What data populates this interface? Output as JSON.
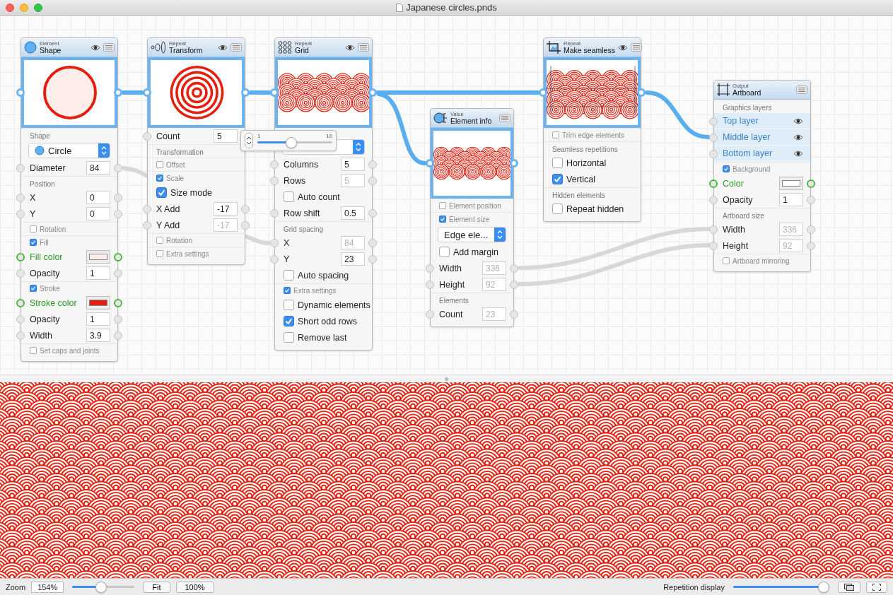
{
  "window": {
    "title": "Japanese circles.pnds"
  },
  "nodes": [
    {
      "category": "Element",
      "title": "Shape",
      "eye": true,
      "rows": [
        {
          "kind": "section",
          "label": "Shape"
        },
        {
          "kind": "select",
          "value": "Circle",
          "dot": true
        },
        {
          "kind": "field",
          "label": "Diameter",
          "value": "84",
          "dimmed": false
        },
        {
          "kind": "section",
          "label": "Position"
        },
        {
          "kind": "field",
          "label": "X",
          "value": "0",
          "dimmed": false
        },
        {
          "kind": "field",
          "label": "Y",
          "value": "0",
          "dimmed": false
        },
        {
          "kind": "toggle",
          "label": "Rotation",
          "checked": false
        },
        {
          "kind": "toggle",
          "label": "Fill",
          "checked": true
        },
        {
          "kind": "color",
          "label": "Fill color",
          "color": "#fdeee9"
        },
        {
          "kind": "field",
          "label": "Opacity",
          "value": "1",
          "dimmed": false
        },
        {
          "kind": "toggle",
          "label": "Stroke",
          "checked": true
        },
        {
          "kind": "color",
          "label": "Stroke color",
          "color": "#e3200f"
        },
        {
          "kind": "field",
          "label": "Opacity",
          "value": "1",
          "dimmed": false
        },
        {
          "kind": "field",
          "label": "Width",
          "value": "3.9",
          "dimmed": false
        },
        {
          "kind": "toggle",
          "label": "Set caps and joints",
          "checked": false
        }
      ]
    },
    {
      "category": "Repeat",
      "title": "Transform",
      "eye": true,
      "rows": [
        {
          "kind": "field",
          "label": "Count",
          "value": "5",
          "dimmed": false
        },
        {
          "kind": "section",
          "label": "Transformation"
        },
        {
          "kind": "toggle",
          "label": "Offset",
          "checked": false
        },
        {
          "kind": "toggle",
          "label": "Scale",
          "checked": true
        },
        {
          "kind": "check",
          "label": "Size mode",
          "checked": true
        },
        {
          "kind": "field",
          "label": "X Add",
          "value": "-17",
          "dimmed": false
        },
        {
          "kind": "field",
          "label": "Y Add",
          "value": "-17",
          "dimmed": true
        },
        {
          "kind": "toggle",
          "label": "Rotation",
          "checked": false
        },
        {
          "kind": "toggle",
          "label": "Extra settings",
          "checked": false
        }
      ]
    },
    {
      "category": "Repeat",
      "title": "Grid",
      "eye": true,
      "rows": [
        {
          "kind": "select",
          "dot": false
        },
        {
          "kind": "field",
          "label": "Columns",
          "value": "5",
          "dimmed": false
        },
        {
          "kind": "field",
          "label": "Rows",
          "value": "5",
          "dimmed": true
        },
        {
          "kind": "check",
          "label": "Auto count",
          "checked": false
        },
        {
          "kind": "field",
          "label": "Row shift",
          "value": "0.5",
          "dimmed": false
        },
        {
          "kind": "section",
          "label": "Grid spacing"
        },
        {
          "kind": "field",
          "label": "X",
          "value": "84",
          "dimmed": true
        },
        {
          "kind": "field",
          "label": "Y",
          "value": "23",
          "dimmed": false
        },
        {
          "kind": "check",
          "label": "Auto spacing",
          "checked": false
        },
        {
          "kind": "toggle",
          "label": "Extra settings",
          "checked": true
        },
        {
          "kind": "check",
          "label": "Dynamic elements",
          "checked": false
        },
        {
          "kind": "check",
          "label": "Short odd rows",
          "checked": true
        },
        {
          "kind": "check",
          "label": "Remove last",
          "checked": false
        }
      ]
    },
    {
      "category": "Value",
      "title": "Element info",
      "eye": false,
      "rows": [
        {
          "kind": "toggle",
          "label": "Element position",
          "checked": false
        },
        {
          "kind": "toggle",
          "label": "Element size",
          "checked": true
        },
        {
          "kind": "select",
          "value": "Edge ele...",
          "dot": false
        },
        {
          "kind": "check",
          "label": "Add margin",
          "checked": false
        },
        {
          "kind": "field",
          "label": "Width",
          "value": "336",
          "dimmed": true
        },
        {
          "kind": "field",
          "label": "Height",
          "value": "92",
          "dimmed": true
        },
        {
          "kind": "section",
          "label": "Elements"
        },
        {
          "kind": "field",
          "label": "Count",
          "value": "23",
          "dimmed": true
        }
      ]
    },
    {
      "category": "Repeat",
      "title": "Make seamless",
      "eye": true,
      "rows": [
        {
          "kind": "toggle",
          "label": "Trim edge elements",
          "checked": false
        },
        {
          "kind": "section",
          "label": "Seamless repetitions"
        },
        {
          "kind": "check",
          "label": "Horizontal",
          "checked": false
        },
        {
          "kind": "check",
          "label": "Vertical",
          "checked": true
        },
        {
          "kind": "section",
          "label": "Hidden elements"
        },
        {
          "kind": "check",
          "label": "Repeat hidden",
          "checked": false
        }
      ]
    },
    {
      "category": "Output",
      "title": "Artboard",
      "eye": false,
      "rows": [
        {
          "kind": "section",
          "label": "Graphics layers"
        },
        {
          "kind": "layer",
          "label": "Top layer"
        },
        {
          "kind": "layer",
          "label": "Middle layer"
        },
        {
          "kind": "layer",
          "label": "Bottom layer"
        },
        {
          "kind": "toggle",
          "label": "Background",
          "checked": true
        },
        {
          "kind": "color",
          "label": "Color",
          "color": "#ffffff"
        },
        {
          "kind": "field",
          "label": "Opacity",
          "value": "1",
          "dimmed": false
        },
        {
          "kind": "section",
          "label": "Artboard size"
        },
        {
          "kind": "field",
          "label": "Width",
          "value": "336",
          "dimmed": true
        },
        {
          "kind": "field",
          "label": "Height",
          "value": "92",
          "dimmed": true
        },
        {
          "kind": "toggle",
          "label": "Artboard mirroring",
          "checked": false
        }
      ]
    }
  ],
  "count_popover": {
    "min_label": "1",
    "max_label": "10",
    "level": 0.44
  },
  "status_bar": {
    "zoom_label": "Zoom",
    "zoom_value": "154%",
    "zoom_slider": {
      "level": 0.45
    },
    "buttons": [
      "Fit",
      "100%"
    ],
    "repetition_label": "Repetition display",
    "repetition_slider": {
      "level": 1.0
    }
  }
}
